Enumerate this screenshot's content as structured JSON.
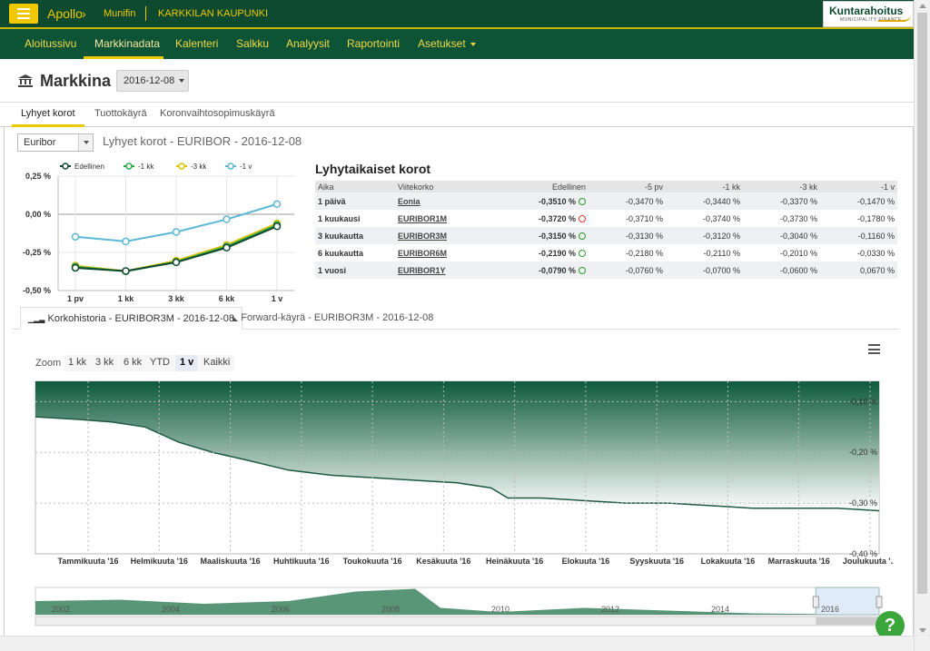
{
  "header": {
    "app_name": "Apollo",
    "org": "Munifin",
    "city": "KARKKILAN KAUPUNKI",
    "logo_main": "Kuntarahoitus",
    "logo_sub": "MUNICIPALITY FINANCE"
  },
  "nav": {
    "items": [
      "Aloitussivu",
      "Markkinadata",
      "Kalenteri",
      "Salkku",
      "Analyysit",
      "Raportointi",
      "Asetukset"
    ],
    "active": "Markkinadata"
  },
  "page": {
    "title": "Markkina",
    "date": "2016-12-08"
  },
  "subtabs": [
    "Lyhyet korot",
    "Tuottokäyrä",
    "Koronvaihtosopimuskäyrä"
  ],
  "rate_select": "Euribor",
  "chart_title": "Lyhyet korot - EURIBOR - 2016-12-08",
  "rates_table": {
    "title": "Lyhytaikaiset korot",
    "headers": [
      "Aika",
      "Viitekorko",
      "Edellinen",
      "-5 pv",
      "-1 kk",
      "-3 kk",
      "-1 v"
    ],
    "rows": [
      [
        "1 päivä",
        "Eonia",
        "-0,3510 %",
        "-0,3470 %",
        "-0,3440 %",
        "-0,3370 %",
        "-0,1470 %"
      ],
      [
        "1 kuukausi",
        "EURIBOR1M",
        "-0,3720 %",
        "-0,3710 %",
        "-0,3740 %",
        "-0,3730 %",
        "-0,1780 %"
      ],
      [
        "3 kuukautta",
        "EURIBOR3M",
        "-0,3150 %",
        "-0,3130 %",
        "-0,3120 %",
        "-0,3040 %",
        "-0,1160 %"
      ],
      [
        "6 kuukautta",
        "EURIBOR6M",
        "-0,2190 %",
        "-0,2180 %",
        "-0,2110 %",
        "-0,2010 %",
        "-0,0330 %"
      ],
      [
        "1 vuosi",
        "EURIBOR1Y",
        "-0,0790 %",
        "-0,0760 %",
        "-0,0700 %",
        "-0,0600 %",
        "0,0670 %"
      ]
    ],
    "trend": [
      "up",
      "down",
      "up",
      "up",
      "up"
    ]
  },
  "lower_tabs": [
    "Korkohistoria - EURIBOR3M - 2016-12-08",
    "Forward-käyrä - EURIBOR3M - 2016-12-08"
  ],
  "zoom": {
    "label": "Zoom",
    "buttons": [
      "1 kk",
      "3 kk",
      "6 kk",
      "YTD",
      "1 v",
      "Kaikki"
    ],
    "active": "1 v"
  },
  "colors": {
    "dark_green": "#0d4a2f",
    "accent_yellow": "#f0c800"
  },
  "chart_data": [
    {
      "type": "line",
      "categories": [
        "1 pv",
        "1 kk",
        "3 kk",
        "6 kk",
        "1 v"
      ],
      "ylim": [
        -0.5,
        0.25
      ],
      "yticks": [
        "0,25 %",
        "0,00 %",
        "-0,25 %",
        "-0,50 %"
      ],
      "legend_position": "top",
      "series": [
        {
          "name": "Edellinen",
          "color": "#0d4a2f",
          "values": [
            -0.351,
            -0.372,
            -0.315,
            -0.219,
            -0.079
          ]
        },
        {
          "name": "-1 kk",
          "color": "#2aa84a",
          "values": [
            -0.344,
            -0.374,
            -0.312,
            -0.211,
            -0.07
          ]
        },
        {
          "name": "-3 kk",
          "color": "#e0c000",
          "values": [
            -0.337,
            -0.373,
            -0.304,
            -0.201,
            -0.06
          ]
        },
        {
          "name": "-1 v",
          "color": "#5bb8d6",
          "values": [
            -0.147,
            -0.178,
            -0.116,
            -0.033,
            0.067
          ]
        }
      ]
    },
    {
      "type": "area",
      "series": "EURIBOR3M",
      "ylim": [
        -0.4,
        -0.06
      ],
      "yticks": [
        "-0,10 %",
        "-0,20 %",
        "-0,30 %",
        "-0,40 %"
      ],
      "xticks": [
        "Tammikuuta '16",
        "Helmikuuta '16",
        "Maaliskuuta '16",
        "Huhtikuuta '16",
        "Toukokuuta '16",
        "Kesäkuuta '16",
        "Heinäkuuta '16",
        "Elokuuta '16",
        "Syyskuuta '16",
        "Lokakuuta '16",
        "Marraskuuta '16",
        "Joulukuuta '..."
      ],
      "x": [
        0,
        0.05,
        0.09,
        0.13,
        0.17,
        0.21,
        0.25,
        0.3,
        0.35,
        0.4,
        0.45,
        0.5,
        0.54,
        0.56,
        0.6,
        0.65,
        0.7,
        0.75,
        0.8,
        0.85,
        0.9,
        0.95,
        1.0
      ],
      "values": [
        -0.13,
        -0.135,
        -0.14,
        -0.15,
        -0.18,
        -0.2,
        -0.215,
        -0.235,
        -0.245,
        -0.25,
        -0.255,
        -0.26,
        -0.27,
        -0.29,
        -0.29,
        -0.295,
        -0.3,
        -0.3,
        -0.305,
        -0.31,
        -0.31,
        -0.31,
        -0.315
      ],
      "navigator_years": [
        "2002",
        "2004",
        "2006",
        "2008",
        "2010",
        "2012",
        "2014",
        "2016"
      ]
    }
  ]
}
